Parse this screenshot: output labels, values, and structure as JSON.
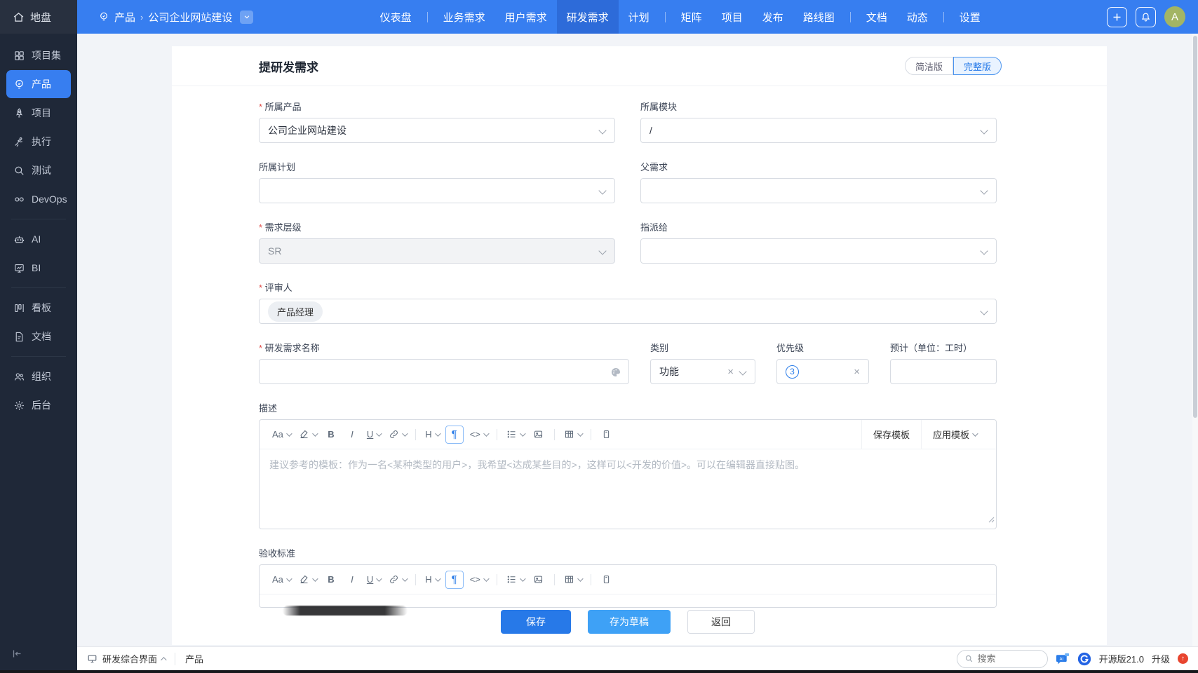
{
  "colors": {
    "topbar_blue": "#377ef0",
    "nav_active_blue": "#2d6bd9",
    "sidebar_bg": "#1f2838",
    "accent_blue": "#2b7de9",
    "save_button_blue": "#2779e8",
    "draft_button_blue": "#3ea1f6",
    "avatar_green": "#a3b564",
    "upgrade_badge_red": "#e8452f"
  },
  "topbar": {
    "home_label": "地盘",
    "breadcrumb": {
      "section": "产品",
      "divider": "›",
      "current": "公司企业网站建设"
    },
    "nav": [
      {
        "label": "仪表盘"
      },
      {
        "label": "业务需求"
      },
      {
        "label": "用户需求"
      },
      {
        "label": "研发需求",
        "active": true
      },
      {
        "label": "计划"
      },
      {
        "label": "矩阵"
      },
      {
        "label": "项目"
      },
      {
        "label": "发布"
      },
      {
        "label": "路线图"
      },
      {
        "label": "文档"
      },
      {
        "label": "动态"
      },
      {
        "label": "设置"
      }
    ],
    "avatar_letter": "A"
  },
  "sidebar": {
    "items": [
      {
        "label": "项目集",
        "icon": "grid-icon"
      },
      {
        "label": "产品",
        "icon": "lightbulb-icon",
        "active": true
      },
      {
        "label": "项目",
        "icon": "rocket-icon"
      },
      {
        "label": "执行",
        "icon": "runner-icon"
      },
      {
        "label": "测试",
        "icon": "search-icon"
      },
      {
        "label": "DevOps",
        "icon": "infinity-icon"
      },
      {
        "label": "AI",
        "icon": "robot-icon"
      },
      {
        "label": "BI",
        "icon": "chart-icon"
      },
      {
        "label": "看板",
        "icon": "kanban-icon"
      },
      {
        "label": "文档",
        "icon": "document-icon"
      },
      {
        "label": "组织",
        "icon": "users-icon"
      },
      {
        "label": "后台",
        "icon": "gear-icon"
      }
    ]
  },
  "page": {
    "title": "提研发需求",
    "toggle": {
      "simple": "简洁版",
      "full": "完整版"
    }
  },
  "form": {
    "product": {
      "label": "所属产品",
      "value": "公司企业网站建设"
    },
    "module": {
      "label": "所属模块",
      "value": "/"
    },
    "plan": {
      "label": "所属计划",
      "value": ""
    },
    "parent": {
      "label": "父需求",
      "value": ""
    },
    "level": {
      "label": "需求层级",
      "value": "SR"
    },
    "assignee": {
      "label": "指派给",
      "value": ""
    },
    "reviewer": {
      "label": "评审人",
      "tag": "产品经理"
    },
    "name": {
      "label": "研发需求名称",
      "value": ""
    },
    "category": {
      "label": "类别",
      "value": "功能"
    },
    "priority": {
      "label": "优先级",
      "value": "3"
    },
    "estimate": {
      "label": "预计（单位：工时）",
      "value": ""
    },
    "description": {
      "label": "描述",
      "placeholder": "建议参考的模板：作为一名<某种类型的用户>，我希望<达成某些目的>，这样可以<开发的价值>。可以在编辑器直接贴图。"
    },
    "acceptance": {
      "label": "验收标准"
    }
  },
  "editor": {
    "save_template": "保存模板",
    "apply_template": "应用模板"
  },
  "actions": {
    "save": "保存",
    "draft": "存为草稿",
    "back": "返回"
  },
  "statusbar": {
    "workspace": "研发综合界面",
    "tab": "产品",
    "search_placeholder": "搜索",
    "version": "开源版21.0",
    "upgrade": "升级"
  }
}
